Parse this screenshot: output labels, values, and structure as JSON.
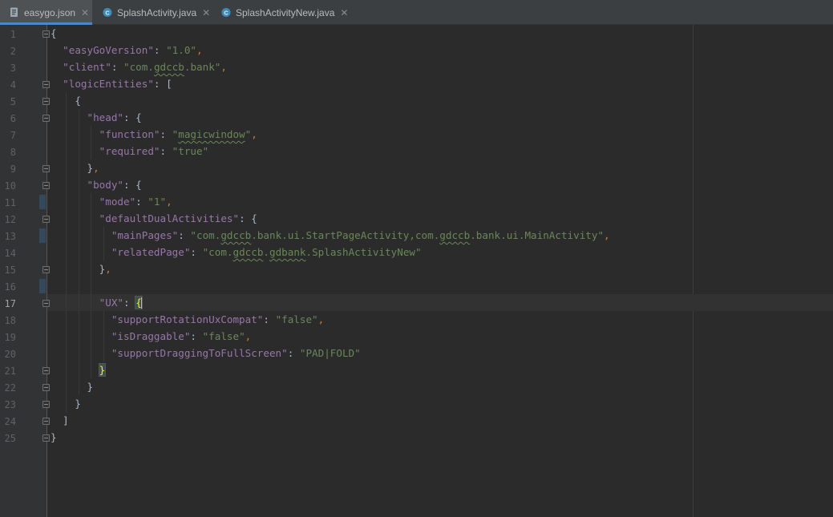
{
  "tabs": [
    {
      "label": "easygo.json",
      "icon": "json-file-icon",
      "active": true,
      "closable": true
    },
    {
      "label": "SplashActivity.java",
      "icon": "java-class-icon",
      "active": false,
      "closable": true
    },
    {
      "label": "SplashActivityNew.java",
      "icon": "java-class-icon",
      "active": false,
      "closable": true
    }
  ],
  "tab_close_glyph": "✕",
  "class_icon_letter": "C",
  "colors": {
    "background": "#2b2b2b",
    "gutter": "#313335",
    "key": "#9876aa",
    "string": "#6a8759",
    "punctuation": "#cc7832",
    "accent": "#4a88c7"
  },
  "editor": {
    "current_line": 17,
    "line_numbers": [
      "1",
      "2",
      "3",
      "4",
      "5",
      "6",
      "7",
      "8",
      "9",
      "10",
      "11",
      "12",
      "13",
      "14",
      "15",
      "16",
      "17",
      "18",
      "19",
      "20",
      "21",
      "22",
      "23",
      "24",
      "25"
    ],
    "lines": [
      {
        "tokens": [
          {
            "t": "{",
            "c": "b"
          }
        ]
      },
      {
        "tokens": [
          {
            "t": "  "
          },
          {
            "t": "\"easyGoVersion\"",
            "c": "k"
          },
          {
            "t": ": ",
            "c": "b"
          },
          {
            "t": "\"1.0\"",
            "c": "s"
          },
          {
            "t": ",",
            "c": "p"
          }
        ]
      },
      {
        "tokens": [
          {
            "t": "  "
          },
          {
            "t": "\"client\"",
            "c": "k"
          },
          {
            "t": ": ",
            "c": "b"
          },
          {
            "t": "\"com.",
            "c": "s"
          },
          {
            "t": "gdccb",
            "c": "s typo"
          },
          {
            "t": ".bank\"",
            "c": "s"
          },
          {
            "t": ",",
            "c": "p"
          }
        ]
      },
      {
        "tokens": [
          {
            "t": "  "
          },
          {
            "t": "\"logicEntities\"",
            "c": "k"
          },
          {
            "t": ": ",
            "c": "b"
          },
          {
            "t": "[",
            "c": "b"
          }
        ]
      },
      {
        "tokens": [
          {
            "t": "    "
          },
          {
            "t": "{",
            "c": "b"
          }
        ]
      },
      {
        "tokens": [
          {
            "t": "      "
          },
          {
            "t": "\"head\"",
            "c": "k"
          },
          {
            "t": ": ",
            "c": "b"
          },
          {
            "t": "{",
            "c": "b"
          }
        ]
      },
      {
        "tokens": [
          {
            "t": "        "
          },
          {
            "t": "\"function\"",
            "c": "k"
          },
          {
            "t": ": ",
            "c": "b"
          },
          {
            "t": "\"",
            "c": "s"
          },
          {
            "t": "magicwindow",
            "c": "s typo"
          },
          {
            "t": "\"",
            "c": "s"
          },
          {
            "t": ",",
            "c": "p"
          }
        ]
      },
      {
        "tokens": [
          {
            "t": "        "
          },
          {
            "t": "\"required\"",
            "c": "k"
          },
          {
            "t": ": ",
            "c": "b"
          },
          {
            "t": "\"true\"",
            "c": "s"
          }
        ]
      },
      {
        "tokens": [
          {
            "t": "      "
          },
          {
            "t": "}",
            "c": "b"
          },
          {
            "t": ",",
            "c": "p"
          }
        ]
      },
      {
        "tokens": [
          {
            "t": "      "
          },
          {
            "t": "\"body\"",
            "c": "k"
          },
          {
            "t": ": ",
            "c": "b"
          },
          {
            "t": "{",
            "c": "b"
          }
        ]
      },
      {
        "tokens": [
          {
            "t": "        "
          },
          {
            "t": "\"mode\"",
            "c": "k"
          },
          {
            "t": ": ",
            "c": "b"
          },
          {
            "t": "\"1\"",
            "c": "s"
          },
          {
            "t": ",",
            "c": "p"
          }
        ]
      },
      {
        "tokens": [
          {
            "t": "        "
          },
          {
            "t": "\"defaultDualActivities\"",
            "c": "k"
          },
          {
            "t": ": ",
            "c": "b"
          },
          {
            "t": "{",
            "c": "b"
          }
        ]
      },
      {
        "tokens": [
          {
            "t": "          "
          },
          {
            "t": "\"mainPages\"",
            "c": "k"
          },
          {
            "t": ": ",
            "c": "b"
          },
          {
            "t": "\"com.",
            "c": "s"
          },
          {
            "t": "gdccb",
            "c": "s typo"
          },
          {
            "t": ".bank.ui.StartPageActivity,com.",
            "c": "s"
          },
          {
            "t": "gdccb",
            "c": "s typo"
          },
          {
            "t": ".bank.ui.MainActivity\"",
            "c": "s"
          },
          {
            "t": ",",
            "c": "p"
          }
        ]
      },
      {
        "tokens": [
          {
            "t": "          "
          },
          {
            "t": "\"relatedPage\"",
            "c": "k"
          },
          {
            "t": ": ",
            "c": "b"
          },
          {
            "t": "\"com.",
            "c": "s"
          },
          {
            "t": "gdccb",
            "c": "s typo"
          },
          {
            "t": ".",
            "c": "s"
          },
          {
            "t": "gdbank",
            "c": "s typo"
          },
          {
            "t": ".SplashActivityNew\"",
            "c": "s"
          }
        ]
      },
      {
        "tokens": [
          {
            "t": "        "
          },
          {
            "t": "}",
            "c": "b"
          },
          {
            "t": ",",
            "c": "p"
          }
        ]
      },
      {
        "tokens": [
          {
            "t": ""
          }
        ]
      },
      {
        "tokens": [
          {
            "t": "        "
          },
          {
            "t": "\"UX\"",
            "c": "k"
          },
          {
            "t": ": ",
            "c": "b"
          },
          {
            "t": "{",
            "c": "bm"
          },
          {
            "t": "",
            "c": "caret"
          }
        ]
      },
      {
        "tokens": [
          {
            "t": "          "
          },
          {
            "t": "\"supportRotationUxCompat\"",
            "c": "k"
          },
          {
            "t": ": ",
            "c": "b"
          },
          {
            "t": "\"false\"",
            "c": "s"
          },
          {
            "t": ",",
            "c": "p"
          }
        ]
      },
      {
        "tokens": [
          {
            "t": "          "
          },
          {
            "t": "\"isDraggable\"",
            "c": "k"
          },
          {
            "t": ": ",
            "c": "b"
          },
          {
            "t": "\"false\"",
            "c": "s"
          },
          {
            "t": ",",
            "c": "p"
          }
        ]
      },
      {
        "tokens": [
          {
            "t": "          "
          },
          {
            "t": "\"supportDraggingToFullScreen\"",
            "c": "k"
          },
          {
            "t": ": ",
            "c": "b"
          },
          {
            "t": "\"PAD|FOLD\"",
            "c": "s"
          }
        ]
      },
      {
        "tokens": [
          {
            "t": "        "
          },
          {
            "t": "}",
            "c": "bm"
          }
        ]
      },
      {
        "tokens": [
          {
            "t": "      "
          },
          {
            "t": "}",
            "c": "b"
          }
        ]
      },
      {
        "tokens": [
          {
            "t": "    "
          },
          {
            "t": "}",
            "c": "b"
          }
        ]
      },
      {
        "tokens": [
          {
            "t": "  "
          },
          {
            "t": "]",
            "c": "b"
          }
        ]
      },
      {
        "tokens": [
          {
            "t": "}",
            "c": "b"
          }
        ]
      }
    ]
  }
}
